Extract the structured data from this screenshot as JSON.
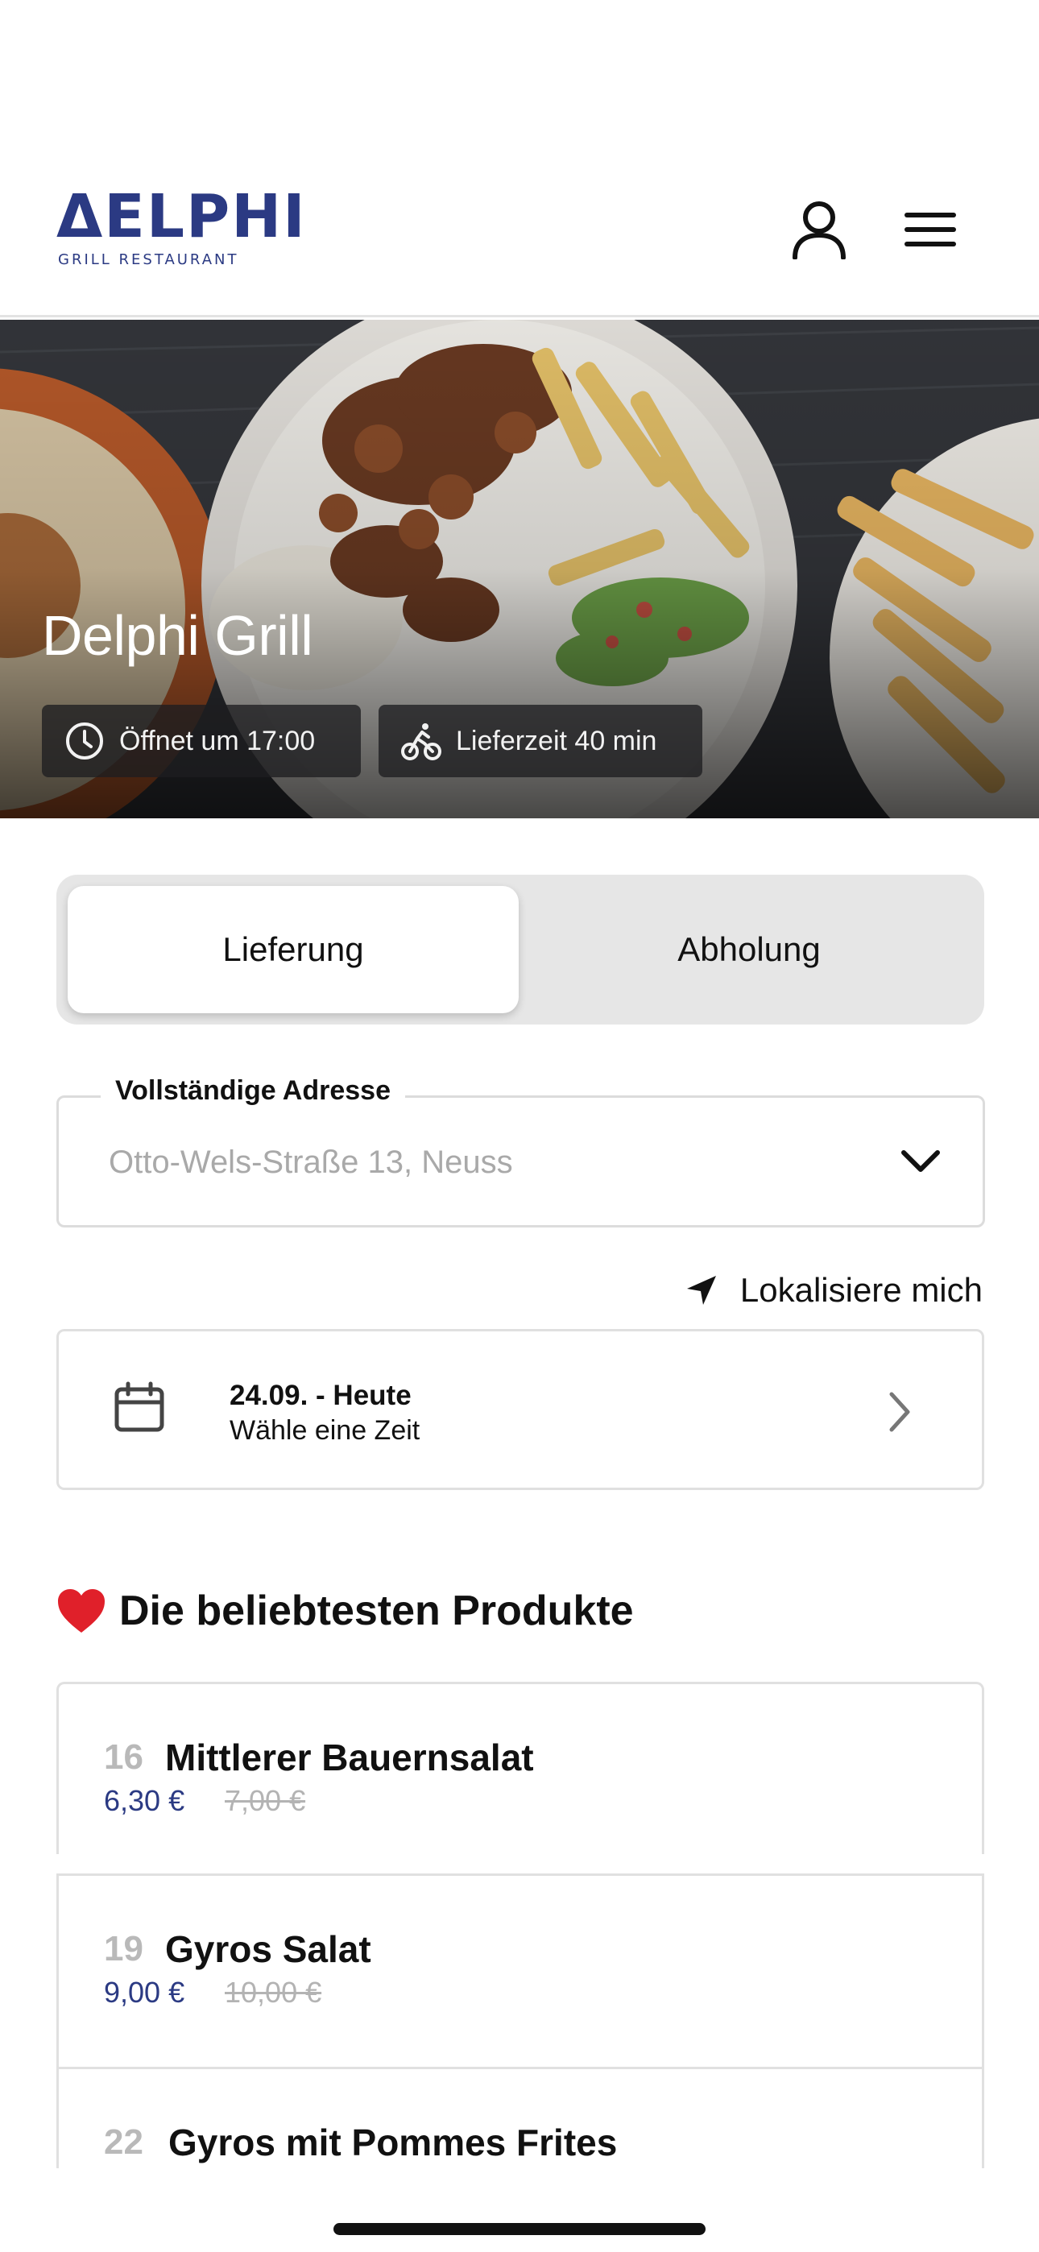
{
  "header": {
    "logo_word": "ΔELPHI",
    "logo_sub": "GRILL RESTAURANT",
    "icons": {
      "user": "user-icon",
      "menu": "hamburger-menu-icon"
    }
  },
  "hero": {
    "title": "Delphi Grill",
    "opening": "Öffnet um 17:00",
    "delivery_time": "Lieferzeit 40 min",
    "icons": {
      "opening": "clock-icon",
      "delivery": "bike-icon"
    }
  },
  "mode_toggle": {
    "options": [
      "Lieferung",
      "Abholung"
    ],
    "selected": "Lieferung"
  },
  "address": {
    "label": "Vollständige Adresse",
    "placeholder": "Otto-Wels-Straße 13, Neuss"
  },
  "locate": {
    "label": "Lokalisiere mich",
    "icon": "location-arrow-icon"
  },
  "date_picker": {
    "title": "24.09. - Heute",
    "subtitle": "Wähle eine Zeit",
    "icon": "calendar-icon"
  },
  "popular": {
    "title": "Die beliebtesten Produkte",
    "icon": "heart-icon",
    "products": [
      {
        "number": "16",
        "name": "Mittlerer Bauernsalat",
        "price": "6,30 €",
        "old_price": "7,00 €"
      },
      {
        "number": "19",
        "name": "Gyros Salat",
        "price": "9,00 €",
        "old_price": "10,00 €"
      },
      {
        "number": "22",
        "name": "Gyros mit Pommes Frites"
      }
    ]
  },
  "colors": {
    "brand": "#2b3a83",
    "heart": "#e0202a",
    "muted": "#a9a9a9"
  }
}
